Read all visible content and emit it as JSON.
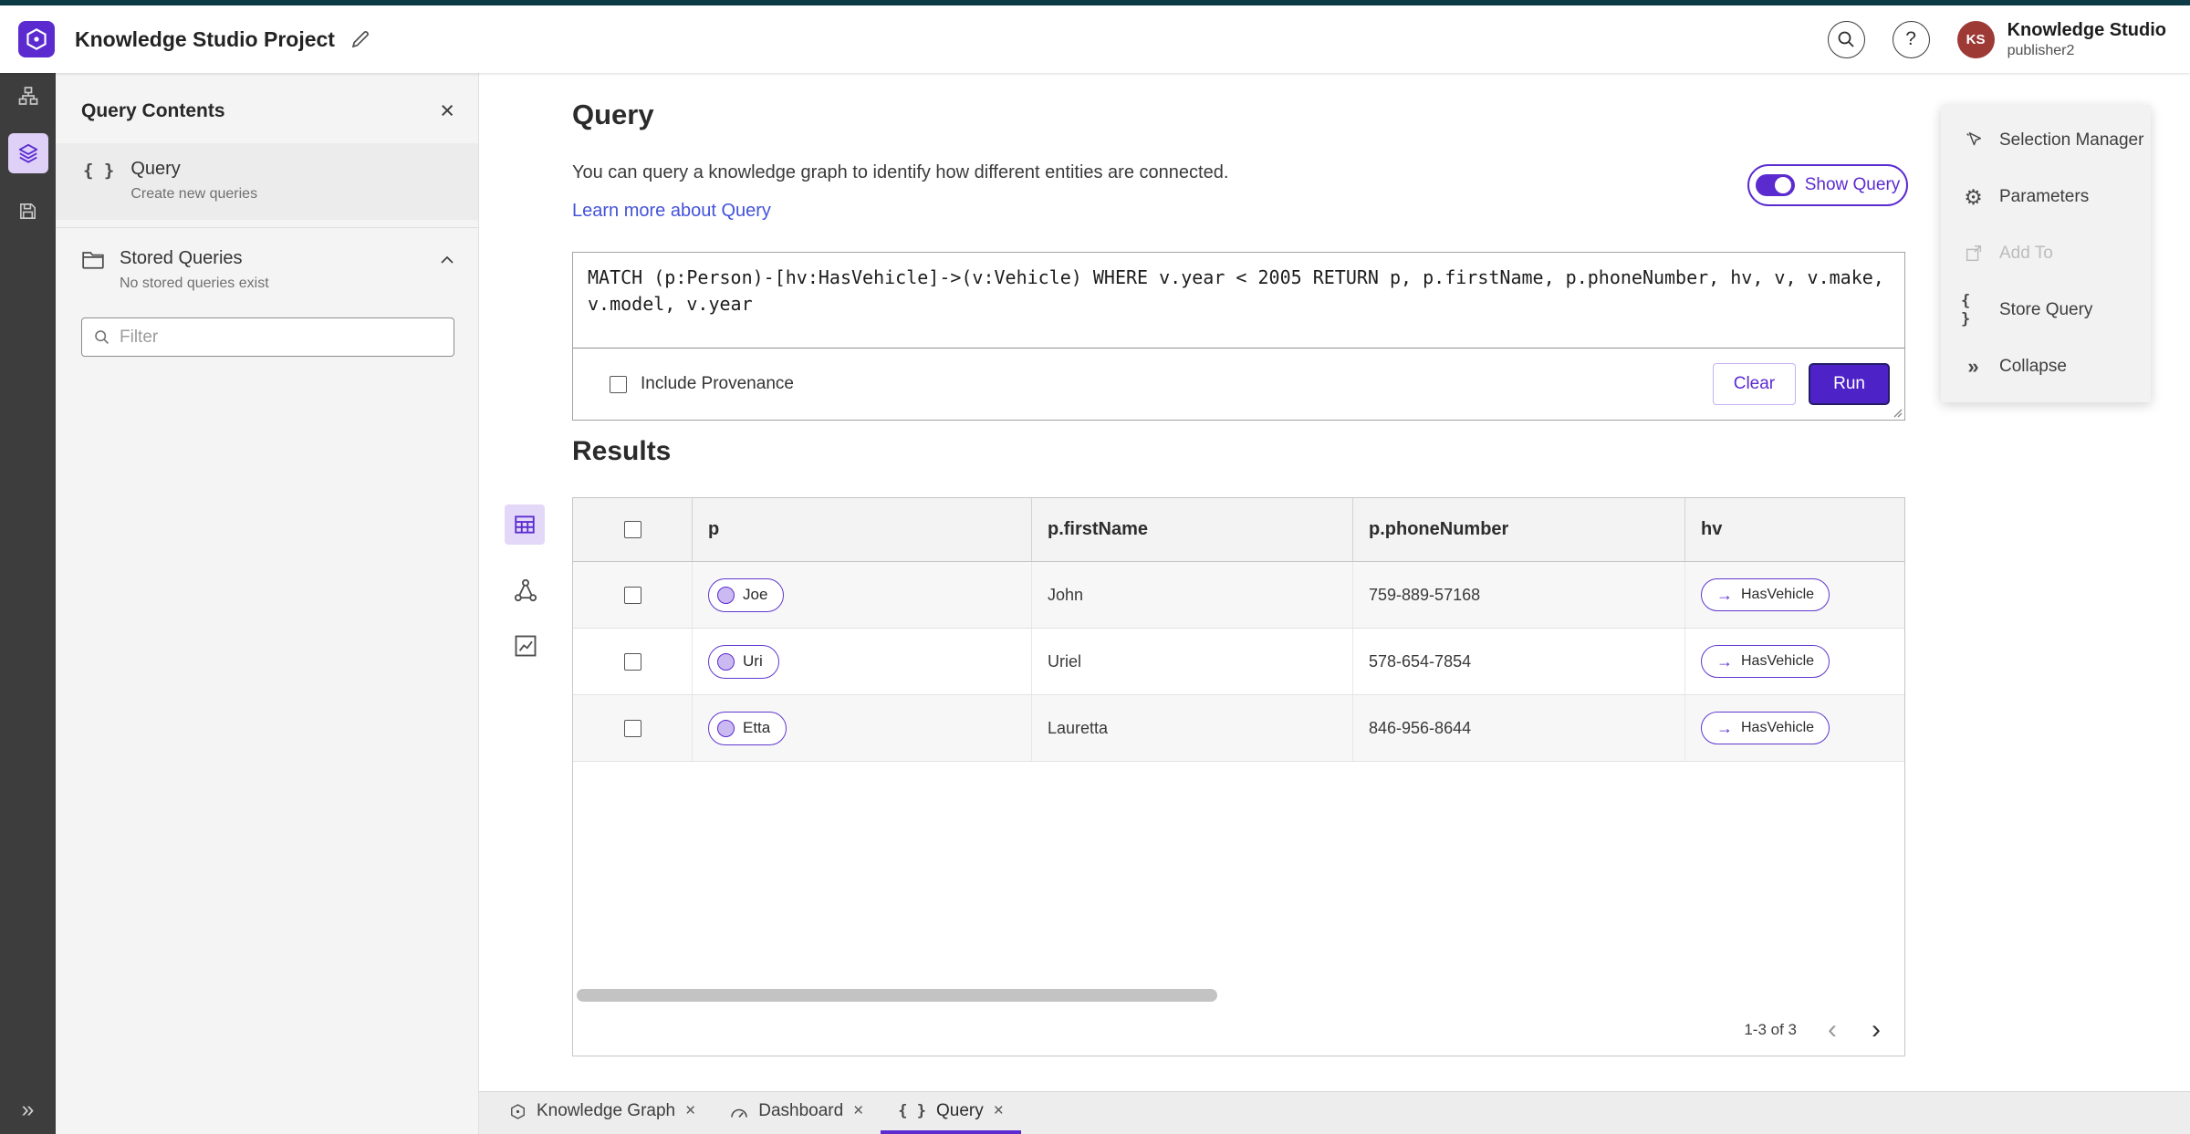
{
  "colors": {
    "accent": "#5b2bd0",
    "run_button": "#4d22c6",
    "link": "#4353d9",
    "avatar_bg": "#9e3a36",
    "rail_bg": "#3d3d3d",
    "panel_bg": "#f4f4f4",
    "top_strip": "#0d3b45"
  },
  "glyphs": {
    "help": "?",
    "close": "×",
    "collapse": "»",
    "expand": "»",
    "braces": "{ }",
    "gear": "⚙",
    "prev": "‹",
    "next": "›",
    "arrow": "→"
  },
  "header": {
    "app_title": "Knowledge Studio Project",
    "user": {
      "initials": "KS",
      "name": "Knowledge Studio",
      "role": "publisher2"
    }
  },
  "left_panel": {
    "title": "Query Contents",
    "query_item": {
      "title": "Query",
      "subtitle": "Create new queries"
    },
    "stored_queries": {
      "title": "Stored Queries",
      "subtitle": "No stored queries exist"
    },
    "filter_placeholder": "Filter"
  },
  "query_section": {
    "title": "Query",
    "description": "You can query a knowledge graph to identify how different entities are connected.",
    "learn_more": "Learn more about Query",
    "show_query": "Show Query",
    "query_text": "MATCH (p:Person)-[hv:HasVehicle]->(v:Vehicle) WHERE v.year < 2005 RETURN p, p.firstName, p.phoneNumber, hv, v, v.make, v.model, v.year",
    "include_provenance": "Include Provenance",
    "clear": "Clear",
    "run": "Run"
  },
  "results": {
    "title": "Results",
    "columns": [
      "p",
      "p.firstName",
      "p.phoneNumber",
      "hv"
    ],
    "rows": [
      {
        "entity": "Joe",
        "first_name": "John",
        "phone": "759-889-57168",
        "relation": "HasVehicle"
      },
      {
        "entity": "Uri",
        "first_name": "Uriel",
        "phone": "578-654-7854",
        "relation": "HasVehicle"
      },
      {
        "entity": "Etta",
        "first_name": "Lauretta",
        "phone": "846-956-8644",
        "relation": "HasVehicle"
      }
    ],
    "pagination": "1-3 of 3"
  },
  "right_menu": {
    "items": [
      {
        "label": "Selection Manager",
        "disabled": false
      },
      {
        "label": "Parameters",
        "disabled": false
      },
      {
        "label": "Add To",
        "disabled": true
      },
      {
        "label": "Store Query",
        "disabled": false
      },
      {
        "label": "Collapse",
        "disabled": false
      }
    ]
  },
  "bottom_tabs": [
    {
      "label": "Knowledge Graph",
      "active": false
    },
    {
      "label": "Dashboard",
      "active": false
    },
    {
      "label": "Query",
      "active": true
    }
  ]
}
